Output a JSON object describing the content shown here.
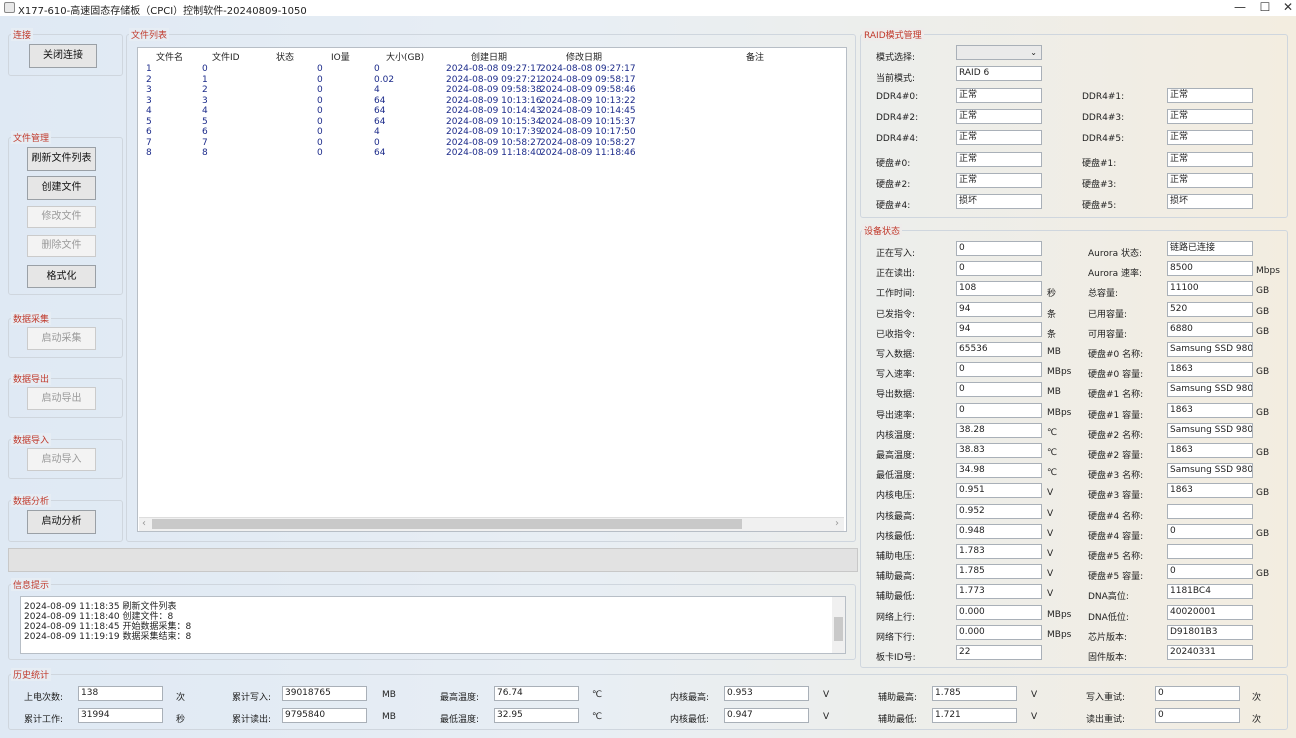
{
  "window": {
    "title": "X177-610-高速固态存储板（CPCI）控制软件-20240809-1050",
    "minimize": "—",
    "maximize": "☐",
    "close": "✕"
  },
  "left": {
    "connect": {
      "title": "连接",
      "close_btn": "关闭连接"
    },
    "file_mgmt": {
      "title": "文件管理",
      "refresh": "刷新文件列表",
      "create": "创建文件",
      "modify": "修改文件",
      "delete": "删除文件",
      "format": "格式化"
    },
    "capture": {
      "title": "数据采集",
      "btn": "启动采集"
    },
    "export": {
      "title": "数据导出",
      "btn": "启动导出"
    },
    "import": {
      "title": "数据导入",
      "btn": "启动导入"
    },
    "analyze": {
      "title": "数据分析",
      "btn": "启动分析"
    }
  },
  "file_list": {
    "title": "文件列表",
    "headers": [
      "文件名",
      "文件ID",
      "状态",
      "IO量",
      "大小(GB)",
      "创建日期",
      "修改日期",
      "备注"
    ],
    "rows": [
      [
        "1",
        "0",
        "",
        "0",
        "0",
        "2024-08-08 09:27:17",
        "2024-08-08 09:27:17",
        ""
      ],
      [
        "2",
        "1",
        "",
        "0",
        "0.02",
        "2024-08-09 09:27:21",
        "2024-08-09 09:58:17",
        ""
      ],
      [
        "3",
        "2",
        "",
        "0",
        "4",
        "2024-08-09 09:58:38",
        "2024-08-09 09:58:46",
        ""
      ],
      [
        "3",
        "3",
        "",
        "0",
        "64",
        "2024-08-09 10:13:16",
        "2024-08-09 10:13:22",
        ""
      ],
      [
        "4",
        "4",
        "",
        "0",
        "64",
        "2024-08-09 10:14:43",
        "2024-08-09 10:14:45",
        ""
      ],
      [
        "5",
        "5",
        "",
        "0",
        "64",
        "2024-08-09 10:15:34",
        "2024-08-09 10:15:37",
        ""
      ],
      [
        "6",
        "6",
        "",
        "0",
        "4",
        "2024-08-09 10:17:39",
        "2024-08-09 10:17:50",
        ""
      ],
      [
        "7",
        "7",
        "",
        "0",
        "0",
        "2024-08-09 10:58:27",
        "2024-08-09 10:58:27",
        ""
      ],
      [
        "8",
        "8",
        "",
        "0",
        "64",
        "2024-08-09 11:18:40",
        "2024-08-09 11:18:46",
        ""
      ]
    ]
  },
  "messages": {
    "title": "信息提示",
    "lines": [
      "2024-08-09 11:18:35 刷新文件列表",
      "2024-08-09 11:18:40 创建文件：8",
      "2024-08-09 11:18:45 开始数据采集：8",
      "2024-08-09 11:19:19 数据采集结束：8"
    ]
  },
  "raid": {
    "title": "RAID模式管理",
    "select_label": "模式选择:",
    "select_value": "",
    "mode_label": "当前模式:",
    "mode_value": "RAID 6",
    "items": [
      {
        "l1": "DDR4#0:",
        "v1": "正常",
        "l2": "DDR4#1:",
        "v2": "正常"
      },
      {
        "l1": "DDR4#2:",
        "v1": "正常",
        "l2": "DDR4#3:",
        "v2": "正常"
      },
      {
        "l1": "DDR4#4:",
        "v1": "正常",
        "l2": "DDR4#5:",
        "v2": "正常"
      },
      {
        "l1": "硬盘#0:",
        "v1": "正常",
        "l2": "硬盘#1:",
        "v2": "正常"
      },
      {
        "l1": "硬盘#2:",
        "v1": "正常",
        "l2": "硬盘#3:",
        "v2": "正常"
      },
      {
        "l1": "硬盘#4:",
        "v1": "损坏",
        "l2": "硬盘#5:",
        "v2": "损坏"
      }
    ]
  },
  "device": {
    "title": "设备状态",
    "rows": [
      {
        "l1": "正在写入:",
        "v1": "0",
        "u1": "",
        "l2": "Aurora 状态:",
        "v2": "链路已连接",
        "u2": ""
      },
      {
        "l1": "正在读出:",
        "v1": "0",
        "u1": "",
        "l2": "Aurora 速率:",
        "v2": "8500",
        "u2": "Mbps"
      },
      {
        "l1": "工作时间:",
        "v1": "108",
        "u1": "秒",
        "l2": "总容量:",
        "v2": "11100",
        "u2": "GB"
      },
      {
        "l1": "已发指令:",
        "v1": "94",
        "u1": "条",
        "l2": "已用容量:",
        "v2": "520",
        "u2": "GB"
      },
      {
        "l1": "已收指令:",
        "v1": "94",
        "u1": "条",
        "l2": "可用容量:",
        "v2": "6880",
        "u2": "GB"
      },
      {
        "l1": "写入数据:",
        "v1": "65536",
        "u1": "MB",
        "l2": "硬盘#0 名称:",
        "v2": "Samsung SSD 980",
        "u2": ""
      },
      {
        "l1": "写入速率:",
        "v1": "0",
        "u1": "MBps",
        "l2": "硬盘#0 容量:",
        "v2": "1863",
        "u2": "GB"
      },
      {
        "l1": "导出数据:",
        "v1": "0",
        "u1": "MB",
        "l2": "硬盘#1 名称:",
        "v2": "Samsung SSD 980",
        "u2": ""
      },
      {
        "l1": "导出速率:",
        "v1": "0",
        "u1": "MBps",
        "l2": "硬盘#1 容量:",
        "v2": "1863",
        "u2": "GB"
      },
      {
        "l1": "内核温度:",
        "v1": "38.28",
        "u1": "℃",
        "l2": "硬盘#2 名称:",
        "v2": "Samsung SSD 980",
        "u2": ""
      },
      {
        "l1": "最高温度:",
        "v1": "38.83",
        "u1": "℃",
        "l2": "硬盘#2 容量:",
        "v2": "1863",
        "u2": "GB"
      },
      {
        "l1": "最低温度:",
        "v1": "34.98",
        "u1": "℃",
        "l2": "硬盘#3 名称:",
        "v2": "Samsung SSD 980",
        "u2": ""
      },
      {
        "l1": "内核电压:",
        "v1": "0.951",
        "u1": "V",
        "l2": "硬盘#3 容量:",
        "v2": "1863",
        "u2": "GB"
      },
      {
        "l1": "内核最高:",
        "v1": "0.952",
        "u1": "V",
        "l2": "硬盘#4 名称:",
        "v2": "",
        "u2": ""
      },
      {
        "l1": "内核最低:",
        "v1": "0.948",
        "u1": "V",
        "l2": "硬盘#4 容量:",
        "v2": "0",
        "u2": "GB"
      },
      {
        "l1": "辅助电压:",
        "v1": "1.783",
        "u1": "V",
        "l2": "硬盘#5 名称:",
        "v2": "",
        "u2": ""
      },
      {
        "l1": "辅助最高:",
        "v1": "1.785",
        "u1": "V",
        "l2": "硬盘#5 容量:",
        "v2": "0",
        "u2": "GB"
      },
      {
        "l1": "辅助最低:",
        "v1": "1.773",
        "u1": "V",
        "l2": "DNA高位:",
        "v2": "1181BC4",
        "u2": ""
      },
      {
        "l1": "网络上行:",
        "v1": "0.000",
        "u1": "MBps",
        "l2": "DNA低位:",
        "v2": "40020001",
        "u2": ""
      },
      {
        "l1": "网络下行:",
        "v1": "0.000",
        "u1": "MBps",
        "l2": "芯片版本:",
        "v2": "D91801B3",
        "u2": ""
      },
      {
        "l1": "板卡ID号:",
        "v1": "22",
        "u1": "",
        "l2": "固件版本:",
        "v2": "20240331",
        "u2": ""
      }
    ]
  },
  "history": {
    "title": "历史统计",
    "row1": [
      {
        "label": "上电次数:",
        "value": "138",
        "unit": "次"
      },
      {
        "label": "累计写入:",
        "value": "39018765",
        "unit": "MB"
      },
      {
        "label": "最高温度:",
        "value": "76.74",
        "unit": "℃"
      },
      {
        "label": "内核最高:",
        "value": "0.953",
        "unit": "V"
      },
      {
        "label": "辅助最高:",
        "value": "1.785",
        "unit": "V"
      },
      {
        "label": "写入重试:",
        "value": "0",
        "unit": "次"
      }
    ],
    "row2": [
      {
        "label": "累计工作:",
        "value": "31994",
        "unit": "秒"
      },
      {
        "label": "累计读出:",
        "value": "9795840",
        "unit": "MB"
      },
      {
        "label": "最低温度:",
        "value": "32.95",
        "unit": "℃"
      },
      {
        "label": "内核最低:",
        "value": "0.947",
        "unit": "V"
      },
      {
        "label": "辅助最低:",
        "value": "1.721",
        "unit": "V"
      },
      {
        "label": "读出重试:",
        "value": "0",
        "unit": "次"
      }
    ]
  }
}
